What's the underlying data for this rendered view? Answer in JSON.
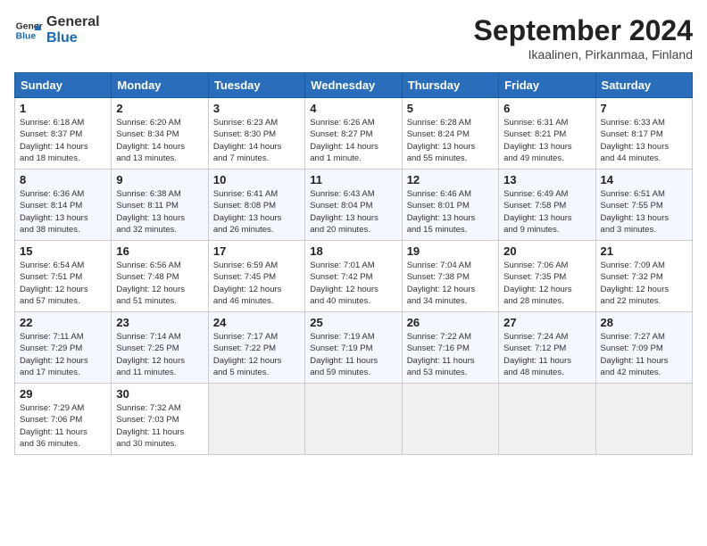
{
  "header": {
    "logo_line1": "General",
    "logo_line2": "Blue",
    "title": "September 2024",
    "subtitle": "Ikaalinen, Pirkanmaa, Finland"
  },
  "weekdays": [
    "Sunday",
    "Monday",
    "Tuesday",
    "Wednesday",
    "Thursday",
    "Friday",
    "Saturday"
  ],
  "weeks": [
    [
      {
        "day": "1",
        "info": "Sunrise: 6:18 AM\nSunset: 8:37 PM\nDaylight: 14 hours\nand 18 minutes."
      },
      {
        "day": "2",
        "info": "Sunrise: 6:20 AM\nSunset: 8:34 PM\nDaylight: 14 hours\nand 13 minutes."
      },
      {
        "day": "3",
        "info": "Sunrise: 6:23 AM\nSunset: 8:30 PM\nDaylight: 14 hours\nand 7 minutes."
      },
      {
        "day": "4",
        "info": "Sunrise: 6:26 AM\nSunset: 8:27 PM\nDaylight: 14 hours\nand 1 minute."
      },
      {
        "day": "5",
        "info": "Sunrise: 6:28 AM\nSunset: 8:24 PM\nDaylight: 13 hours\nand 55 minutes."
      },
      {
        "day": "6",
        "info": "Sunrise: 6:31 AM\nSunset: 8:21 PM\nDaylight: 13 hours\nand 49 minutes."
      },
      {
        "day": "7",
        "info": "Sunrise: 6:33 AM\nSunset: 8:17 PM\nDaylight: 13 hours\nand 44 minutes."
      }
    ],
    [
      {
        "day": "8",
        "info": "Sunrise: 6:36 AM\nSunset: 8:14 PM\nDaylight: 13 hours\nand 38 minutes."
      },
      {
        "day": "9",
        "info": "Sunrise: 6:38 AM\nSunset: 8:11 PM\nDaylight: 13 hours\nand 32 minutes."
      },
      {
        "day": "10",
        "info": "Sunrise: 6:41 AM\nSunset: 8:08 PM\nDaylight: 13 hours\nand 26 minutes."
      },
      {
        "day": "11",
        "info": "Sunrise: 6:43 AM\nSunset: 8:04 PM\nDaylight: 13 hours\nand 20 minutes."
      },
      {
        "day": "12",
        "info": "Sunrise: 6:46 AM\nSunset: 8:01 PM\nDaylight: 13 hours\nand 15 minutes."
      },
      {
        "day": "13",
        "info": "Sunrise: 6:49 AM\nSunset: 7:58 PM\nDaylight: 13 hours\nand 9 minutes."
      },
      {
        "day": "14",
        "info": "Sunrise: 6:51 AM\nSunset: 7:55 PM\nDaylight: 13 hours\nand 3 minutes."
      }
    ],
    [
      {
        "day": "15",
        "info": "Sunrise: 6:54 AM\nSunset: 7:51 PM\nDaylight: 12 hours\nand 57 minutes."
      },
      {
        "day": "16",
        "info": "Sunrise: 6:56 AM\nSunset: 7:48 PM\nDaylight: 12 hours\nand 51 minutes."
      },
      {
        "day": "17",
        "info": "Sunrise: 6:59 AM\nSunset: 7:45 PM\nDaylight: 12 hours\nand 46 minutes."
      },
      {
        "day": "18",
        "info": "Sunrise: 7:01 AM\nSunset: 7:42 PM\nDaylight: 12 hours\nand 40 minutes."
      },
      {
        "day": "19",
        "info": "Sunrise: 7:04 AM\nSunset: 7:38 PM\nDaylight: 12 hours\nand 34 minutes."
      },
      {
        "day": "20",
        "info": "Sunrise: 7:06 AM\nSunset: 7:35 PM\nDaylight: 12 hours\nand 28 minutes."
      },
      {
        "day": "21",
        "info": "Sunrise: 7:09 AM\nSunset: 7:32 PM\nDaylight: 12 hours\nand 22 minutes."
      }
    ],
    [
      {
        "day": "22",
        "info": "Sunrise: 7:11 AM\nSunset: 7:29 PM\nDaylight: 12 hours\nand 17 minutes."
      },
      {
        "day": "23",
        "info": "Sunrise: 7:14 AM\nSunset: 7:25 PM\nDaylight: 12 hours\nand 11 minutes."
      },
      {
        "day": "24",
        "info": "Sunrise: 7:17 AM\nSunset: 7:22 PM\nDaylight: 12 hours\nand 5 minutes."
      },
      {
        "day": "25",
        "info": "Sunrise: 7:19 AM\nSunset: 7:19 PM\nDaylight: 11 hours\nand 59 minutes."
      },
      {
        "day": "26",
        "info": "Sunrise: 7:22 AM\nSunset: 7:16 PM\nDaylight: 11 hours\nand 53 minutes."
      },
      {
        "day": "27",
        "info": "Sunrise: 7:24 AM\nSunset: 7:12 PM\nDaylight: 11 hours\nand 48 minutes."
      },
      {
        "day": "28",
        "info": "Sunrise: 7:27 AM\nSunset: 7:09 PM\nDaylight: 11 hours\nand 42 minutes."
      }
    ],
    [
      {
        "day": "29",
        "info": "Sunrise: 7:29 AM\nSunset: 7:06 PM\nDaylight: 11 hours\nand 36 minutes."
      },
      {
        "day": "30",
        "info": "Sunrise: 7:32 AM\nSunset: 7:03 PM\nDaylight: 11 hours\nand 30 minutes."
      },
      {
        "day": "",
        "info": ""
      },
      {
        "day": "",
        "info": ""
      },
      {
        "day": "",
        "info": ""
      },
      {
        "day": "",
        "info": ""
      },
      {
        "day": "",
        "info": ""
      }
    ]
  ]
}
